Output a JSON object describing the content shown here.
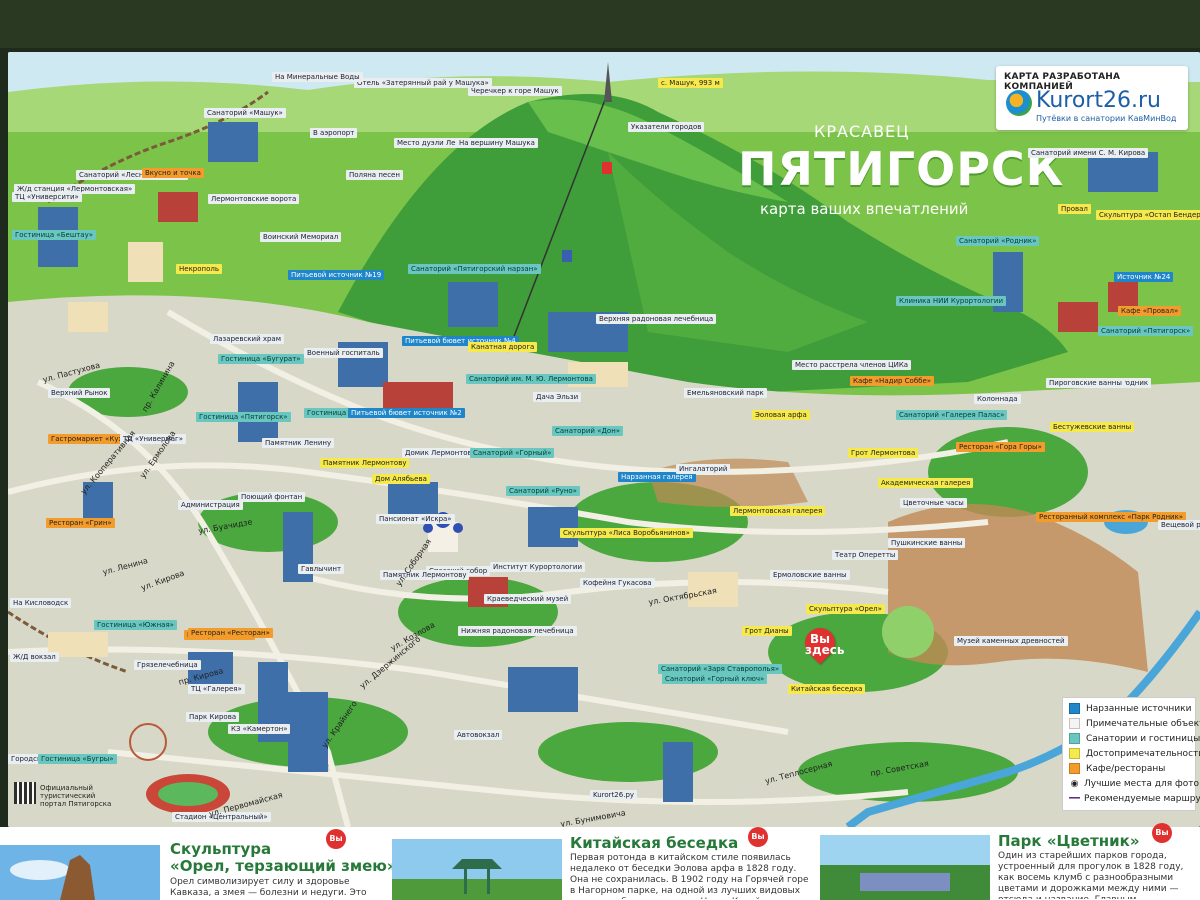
{
  "header": {
    "brand_caption": "КАРТА РАЗРАБОТАНА КОМПАНИЕЙ",
    "brand_site": "Kurort26.ru",
    "brand_sub": "Путёвки в санатории КавМинВод",
    "title_small": "КРАСАВЕЦ",
    "title_big": "ПЯТИГОРСК",
    "title_sub": "карта ваших впечатлений"
  },
  "map": {
    "labels": [
      {
        "text": "Санаторий «Машук»",
        "color": "gray"
      },
      {
        "text": "Санаторий «Лесная поляна»",
        "color": "gray"
      },
      {
        "text": "Ж/д станция «Лермонтовская»",
        "color": "gray"
      },
      {
        "text": "ТЦ «Университи»",
        "color": "gray"
      },
      {
        "text": "Вкусно и точка",
        "color": "orange"
      },
      {
        "text": "Гостиница «Бештау»",
        "color": "teal"
      },
      {
        "text": "Лермонтовские ворота",
        "color": "gray"
      },
      {
        "text": "Воинский Мемориал",
        "color": "gray"
      },
      {
        "text": "Некрополь",
        "color": "yellow"
      },
      {
        "text": "Питьевой источник №19",
        "color": "blue"
      },
      {
        "text": "Санаторий «Пятигорский нарзан»",
        "color": "teal"
      },
      {
        "text": "Поляна песен",
        "color": "gray"
      },
      {
        "text": "Место дуэли Лермонтова",
        "color": "gray"
      },
      {
        "text": "На вершину Машука",
        "color": "gray"
      },
      {
        "text": "Черечкер к горе Машук",
        "color": "gray"
      },
      {
        "text": "Отель «Затерянный рай у Машука»",
        "color": "gray"
      },
      {
        "text": "На Минеральные Воды",
        "color": "gray"
      },
      {
        "text": "В аэропорт",
        "color": "gray"
      },
      {
        "text": "Указатели городов",
        "color": "gray"
      },
      {
        "text": "Провал",
        "color": "yellow"
      },
      {
        "text": "Скульптура «Остап Бендер»",
        "color": "yellow"
      },
      {
        "text": "Санаторий «Родник»",
        "color": "teal"
      },
      {
        "text": "Санаторий имени С. М. Кирова",
        "color": "gray"
      },
      {
        "text": "Источник №24",
        "color": "blue"
      },
      {
        "text": "Кафе «Провал»",
        "color": "orange"
      },
      {
        "text": "Клиника НИИ Курортологии",
        "color": "teal"
      },
      {
        "text": "Санаторий «Пятигорск»",
        "color": "teal"
      },
      {
        "text": "Парк Родник",
        "color": "gray"
      },
      {
        "text": "Пироговские ванны",
        "color": "gray"
      },
      {
        "text": "Колоннада",
        "color": "gray"
      },
      {
        "text": "Бестужевские ванны",
        "color": "yellow"
      },
      {
        "text": "Ресторан «Гора Горы»",
        "color": "orange"
      },
      {
        "text": "Верхняя радоновая лечебница",
        "color": "gray"
      },
      {
        "text": "Лазаревский храм",
        "color": "gray"
      },
      {
        "text": "Военный госпиталь",
        "color": "gray"
      },
      {
        "text": "Питьевой бювет источник №4",
        "color": "blue"
      },
      {
        "text": "Канатная дорога",
        "color": "yellow"
      },
      {
        "text": "Санаторий им. М. Ю. Лермонтова",
        "color": "teal"
      },
      {
        "text": "Место расстрела членов ЦИКа",
        "color": "gray"
      },
      {
        "text": "Кафе «Надир Соббе»",
        "color": "orange"
      },
      {
        "text": "Санаторий «Галерея Палас»",
        "color": "teal"
      },
      {
        "text": "Эоловая арфа",
        "color": "yellow"
      },
      {
        "text": "Дача Эльзи",
        "color": "gray"
      },
      {
        "text": "Емельяновский парк",
        "color": "gray"
      },
      {
        "text": "Грот Лермонтова",
        "color": "yellow"
      },
      {
        "text": "Гостиница «Бугурат»",
        "color": "teal"
      },
      {
        "text": "Верхний Рынок",
        "color": "gray"
      },
      {
        "text": "Гастромаркет «Кухни мира»",
        "color": "orange"
      },
      {
        "text": "ТЦ «Универмаг»",
        "color": "gray"
      },
      {
        "text": "Гостиница «Пятигорск»",
        "color": "teal"
      },
      {
        "text": "Гостиница «Бристоль»",
        "color": "teal"
      },
      {
        "text": "Питьевой бювет источник №2",
        "color": "blue"
      },
      {
        "text": "Памятник Ленину",
        "color": "gray"
      },
      {
        "text": "Санаторий «Дон»",
        "color": "teal"
      },
      {
        "text": "Домик Лермонтова",
        "color": "gray"
      },
      {
        "text": "Санаторий «Горный»",
        "color": "teal"
      },
      {
        "text": "Памятник Лермонтову",
        "color": "yellow"
      },
      {
        "text": "Дом Алябьева",
        "color": "yellow"
      },
      {
        "text": "Ресторан «Грин»",
        "color": "orange"
      },
      {
        "text": "Поющий фонтан",
        "color": "gray"
      },
      {
        "text": "Администрация",
        "color": "gray"
      },
      {
        "text": "Пансионат «Искра»",
        "color": "gray"
      },
      {
        "text": "Санаторий «Руно»",
        "color": "teal"
      },
      {
        "text": "Нарзанная галерея",
        "color": "blue"
      },
      {
        "text": "Ингалаторий",
        "color": "gray"
      },
      {
        "text": "Академическая галерея",
        "color": "yellow"
      },
      {
        "text": "Цветочные часы",
        "color": "gray"
      },
      {
        "text": "Лермонтовская галерея",
        "color": "yellow"
      },
      {
        "text": "Скульптура «Лиса Воробьянинов»",
        "color": "yellow"
      },
      {
        "text": "Пушкинские ванны",
        "color": "gray"
      },
      {
        "text": "Ресторанный комплекс «Парк Родник»",
        "color": "orange"
      },
      {
        "text": "Вещевой рынок «Лира»",
        "color": "gray"
      },
      {
        "text": "Театр Оперетты",
        "color": "gray"
      },
      {
        "text": "Кофейня Гукасова",
        "color": "gray"
      },
      {
        "text": "Спасский собор",
        "color": "gray"
      },
      {
        "text": "Институт Курортологии",
        "color": "gray"
      },
      {
        "text": "Гавлычинт",
        "color": "gray"
      },
      {
        "text": "Ресторан «Ballet»",
        "color": "orange"
      },
      {
        "text": "Памятник Лермонтову",
        "color": "gray"
      },
      {
        "text": "Ермоловские ванны",
        "color": "gray"
      },
      {
        "text": "Краеведческий музей",
        "color": "gray"
      },
      {
        "text": "Нижняя радоновая лечебница",
        "color": "gray"
      },
      {
        "text": "Грот Дианы",
        "color": "yellow"
      },
      {
        "text": "Скульптура «Орел»",
        "color": "yellow"
      },
      {
        "text": "Музей каменных древностей",
        "color": "gray"
      },
      {
        "text": "На Кисловодск",
        "color": "gray"
      },
      {
        "text": "Гостиница «Южная»",
        "color": "teal"
      },
      {
        "text": "Ресторан «Ресторан»",
        "color": "orange"
      },
      {
        "text": "Ж/Д вокзал",
        "color": "gray"
      },
      {
        "text": "Грязелечебница",
        "color": "gray"
      },
      {
        "text": "Санаторий «Заря Ставрополья»",
        "color": "teal"
      },
      {
        "text": "Санаторий «Горный ключ»",
        "color": "teal"
      },
      {
        "text": "Китайская беседка",
        "color": "yellow"
      },
      {
        "text": "ТЦ «Галерея»",
        "color": "gray"
      },
      {
        "text": "Парк Кирова",
        "color": "gray"
      },
      {
        "text": "КЗ «Камертон»",
        "color": "gray"
      },
      {
        "text": "Автовокзал",
        "color": "gray"
      },
      {
        "text": "Городское озеро",
        "color": "gray"
      },
      {
        "text": "Гостиница «Бугры»",
        "color": "teal"
      },
      {
        "text": "Стадион «Центральный»",
        "color": "gray"
      },
      {
        "text": "Kurort26.ру",
        "color": "gray"
      },
      {
        "text": "c. Машук, 993 м",
        "color": "yellow"
      }
    ],
    "streets": [
      "ул. Пастухова",
      "пр. Калинина",
      "ул. Кооперативная",
      "ул. Ермолова",
      "ул. Кирова",
      "пр. Кирова",
      "ул. Крайнего",
      "ул. Дзержинского",
      "ул. Ленина",
      "ул. Теплосерная",
      "ул. Буачидзе",
      "ул. Соборная",
      "ул. Первомайская",
      "ул. Бунимовича",
      "пр. Советская",
      "ул. Октябрьская",
      "ул. Козлова"
    ],
    "you_are_here": "Вы здесь",
    "portal_text": "Официальный туристический портал Пятигорска"
  },
  "legend": {
    "items": [
      {
        "label": "Нарзанные источники",
        "color": "#1f86c9"
      },
      {
        "label": "Примечательные объекты",
        "color": "#f4f4f4"
      },
      {
        "label": "Санатории и гостиницы",
        "color": "#69c7c0"
      },
      {
        "label": "Достопримечательности",
        "color": "#f6e94b"
      },
      {
        "label": "Кафе/рестораны",
        "color": "#f39c2b"
      }
    ],
    "photo_spots": "Лучшие места для фото",
    "routes": "Рекомендуемые маршруты"
  },
  "bottom_cards": [
    {
      "title_line1": "Скульптура",
      "title_line2": "«Орел, терзающий змею»",
      "text": "Орел символизирует силу и здоровье Кавказа, а змея — болезни и недуги. Это самый известный символ Пятигор-",
      "vy": "Вы здесь"
    },
    {
      "title_line1": "Китайская беседка",
      "text": "Первая ротонда в китайском стиле появилась недалеко от беседки Эолова арфа в 1828 году. Она не сохранилась. В 1902 году на Горячей горе в Нагорном парке, на одной из лучших видовых площадок была построена Новая Китайская беседка — на высоком каменном цоколе, деревянная, с цветными сте-",
      "vy": "Вы здесь"
    },
    {
      "title_line1": "Парк «Цветник»",
      "text": "Один из старейших парков города, устроенный для прогулок в 1828 году, как восемь клумб с разнообразными цветами и дорожками между ними — отсюда и название. Главным украшением парка к началу XX века стала Лермонтовская галерея.",
      "vy": "Вы здесь"
    }
  ]
}
